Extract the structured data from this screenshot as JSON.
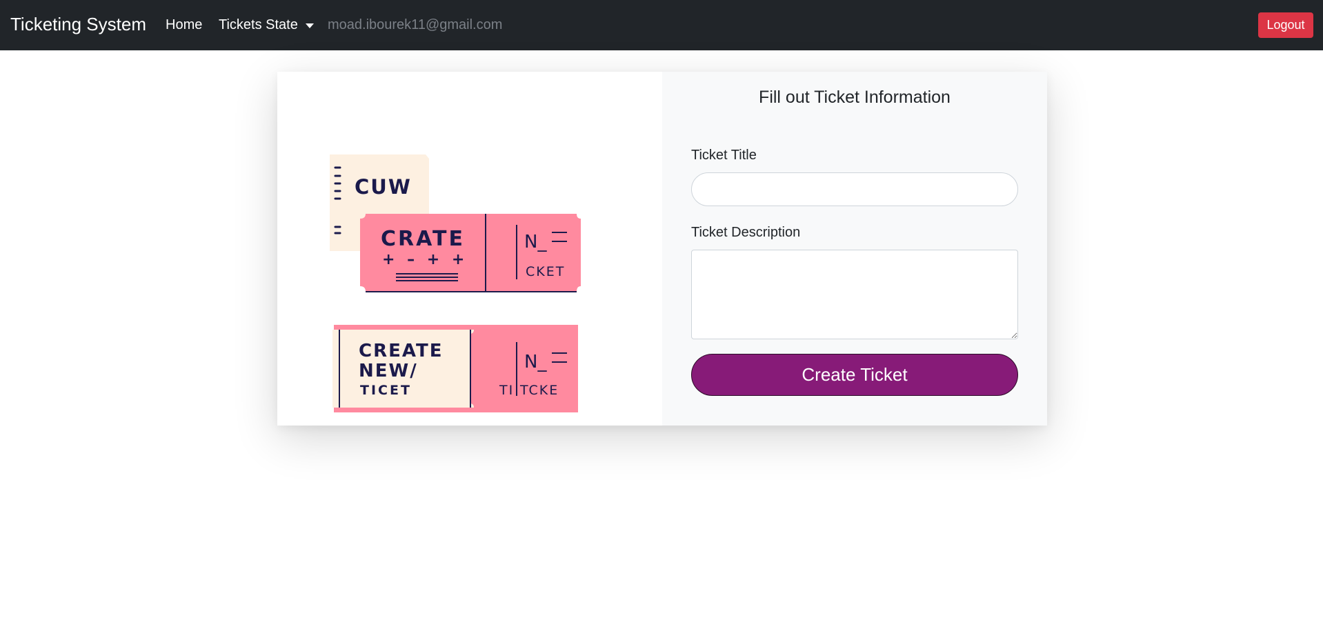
{
  "navbar": {
    "brand": "Ticketing System",
    "home_label": "Home",
    "tickets_state_label": "Tickets State",
    "user_email": "moad.ibourek11@gmail.com",
    "logout_label": "Logout"
  },
  "form": {
    "title": "Fill out Ticket Information",
    "ticket_title_label": "Ticket Title",
    "ticket_title_value": "",
    "ticket_description_label": "Ticket Description",
    "ticket_description_value": "",
    "submit_label": "Create Ticket"
  },
  "illustration": {
    "ticket_back_text": "CUW",
    "ticket_middle_main": "CRATE",
    "ticket_middle_symbols": "+ – + +",
    "ticket_middle_stub_top": "N_",
    "ticket_middle_stub_bottom": "CKET",
    "ticket_front_line1": "CREATE",
    "ticket_front_line2": "NEW/",
    "ticket_front_line3": "TICET",
    "ticket_front_stub_top": "N_",
    "ticket_front_stub_bottom_a": "TI",
    "ticket_front_stub_bottom_b": "TCKE"
  },
  "colors": {
    "navbar_bg": "#212529",
    "logout_bg": "#dc3545",
    "submit_bg": "#871b78",
    "ticket_pink": "#ff8a9f",
    "ticket_cream": "#fdf0e1",
    "ticket_ink": "#1b1a4b"
  }
}
